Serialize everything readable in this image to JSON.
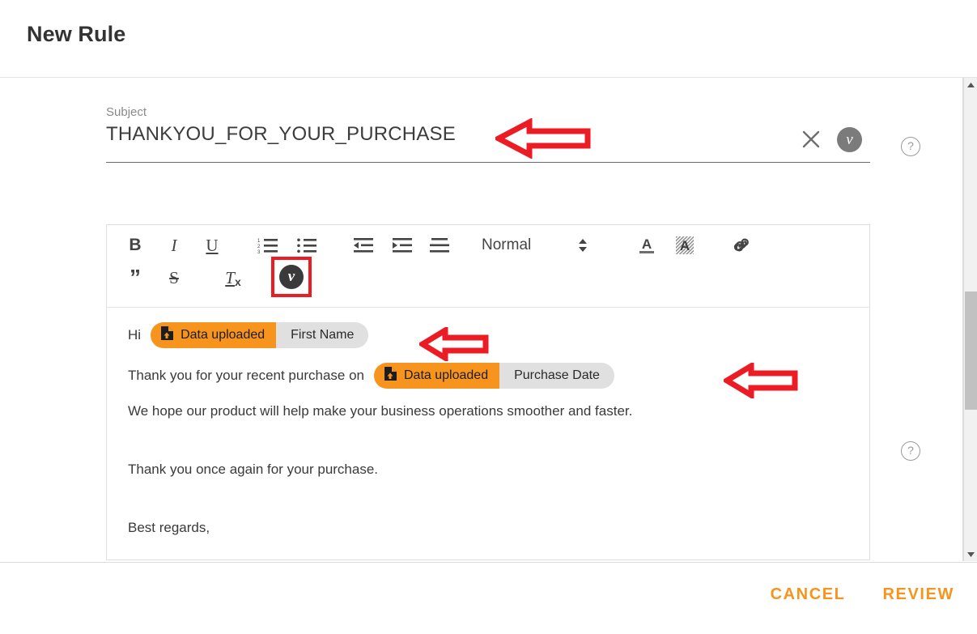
{
  "header": {
    "title": "New Rule"
  },
  "subject": {
    "label": "Subject",
    "value": "THANKYOU_FOR_YOUR_PURCHASE",
    "clear_icon": "close-icon",
    "variable_badge": "v"
  },
  "help": {
    "icon": "question-mark-icon",
    "glyph": "?"
  },
  "toolbar": {
    "bold": "B",
    "italic": "I",
    "underline": "U",
    "ordered_list": "ordered-list-icon",
    "bullet_list": "bullet-list-icon",
    "outdent": "outdent-icon",
    "indent": "indent-icon",
    "align": "align-icon",
    "block_format": "Normal",
    "block_format_icon": "updown-chevron-icon",
    "font_color": "font-color-icon",
    "background_color": "background-color-icon",
    "link": "link-icon",
    "blockquote": "”",
    "strikethrough": "S",
    "clear_format": "T",
    "clear_format_sub": "x",
    "variable_button": "v"
  },
  "body": {
    "greeting_prefix": "Hi",
    "line2_prefix": "Thank you for your recent purchase on",
    "paragraph1": "We hope our product will help make your business operations smoother and faster.",
    "paragraph2": "Thank you once again for your purchase.",
    "paragraph3": "Best regards,",
    "tokens": [
      {
        "source": "Data uploaded",
        "field": "First Name",
        "icon": "file-upload-icon"
      },
      {
        "source": "Data uploaded",
        "field": "Purchase Date",
        "icon": "file-upload-icon"
      }
    ]
  },
  "footer": {
    "cancel_label": "CANCEL",
    "review_label": "REVIEW"
  },
  "colors": {
    "accent_orange": "#f7941e",
    "token_field_grey": "#e0e0e0",
    "annotation_red": "#ec1c24",
    "badge_grey": "#7b7b7b",
    "text_dark": "#333333"
  },
  "annotations": [
    {
      "name": "arrow-subject",
      "points_to": "subject-value",
      "direction": "left"
    },
    {
      "name": "arrow-token-first-name",
      "points_to": "token-first-name",
      "direction": "left"
    },
    {
      "name": "arrow-token-purchase-date",
      "points_to": "token-purchase-date",
      "direction": "left"
    },
    {
      "name": "highlight-variable-toolbar-button",
      "points_to": "toolbar-variable-button",
      "shape": "rectangle"
    }
  ]
}
